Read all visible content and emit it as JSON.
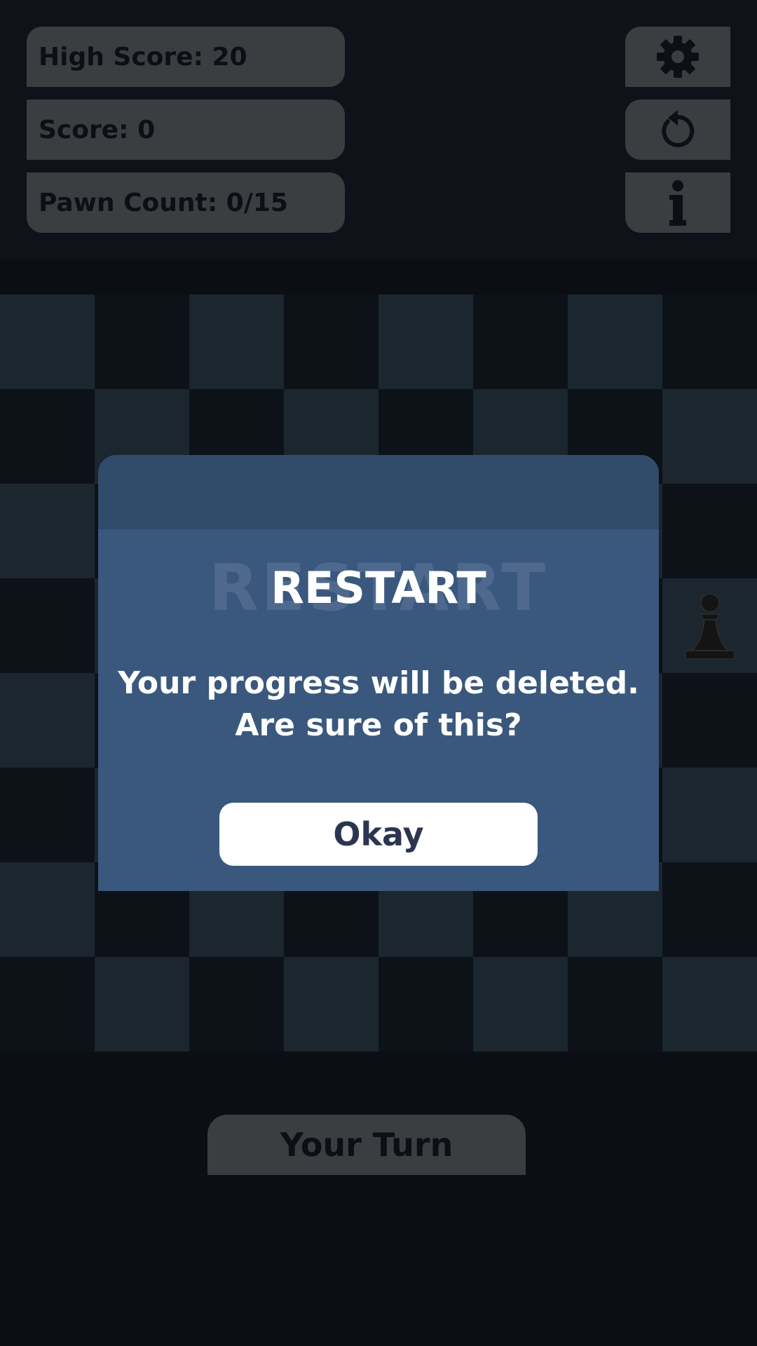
{
  "stats": {
    "high_score": "High Score: 20",
    "score": "Score: 0",
    "pawn_count": "Pawn Count: 0/15"
  },
  "buttons": {
    "settings_icon": "gear-icon",
    "restart_icon": "restart-icon",
    "info_icon": "info-icon"
  },
  "board": {
    "size": 8,
    "light_color": "#1b262f",
    "dark_color": "#0d1219",
    "pieces": [
      {
        "type": "pawn",
        "color": "black",
        "square": "h5"
      }
    ]
  },
  "dialog": {
    "title": "RESTART",
    "message_line1": "Your progress will be deleted.",
    "message_line2": "Are sure of this?",
    "confirm_label": "Okay"
  },
  "turn_label": "Your Turn",
  "colors": {
    "dialog_bg": "#3a587d",
    "dialog_header": "#314b6b",
    "button_bg": "#3c3d40",
    "okay_text": "#2c3550"
  }
}
